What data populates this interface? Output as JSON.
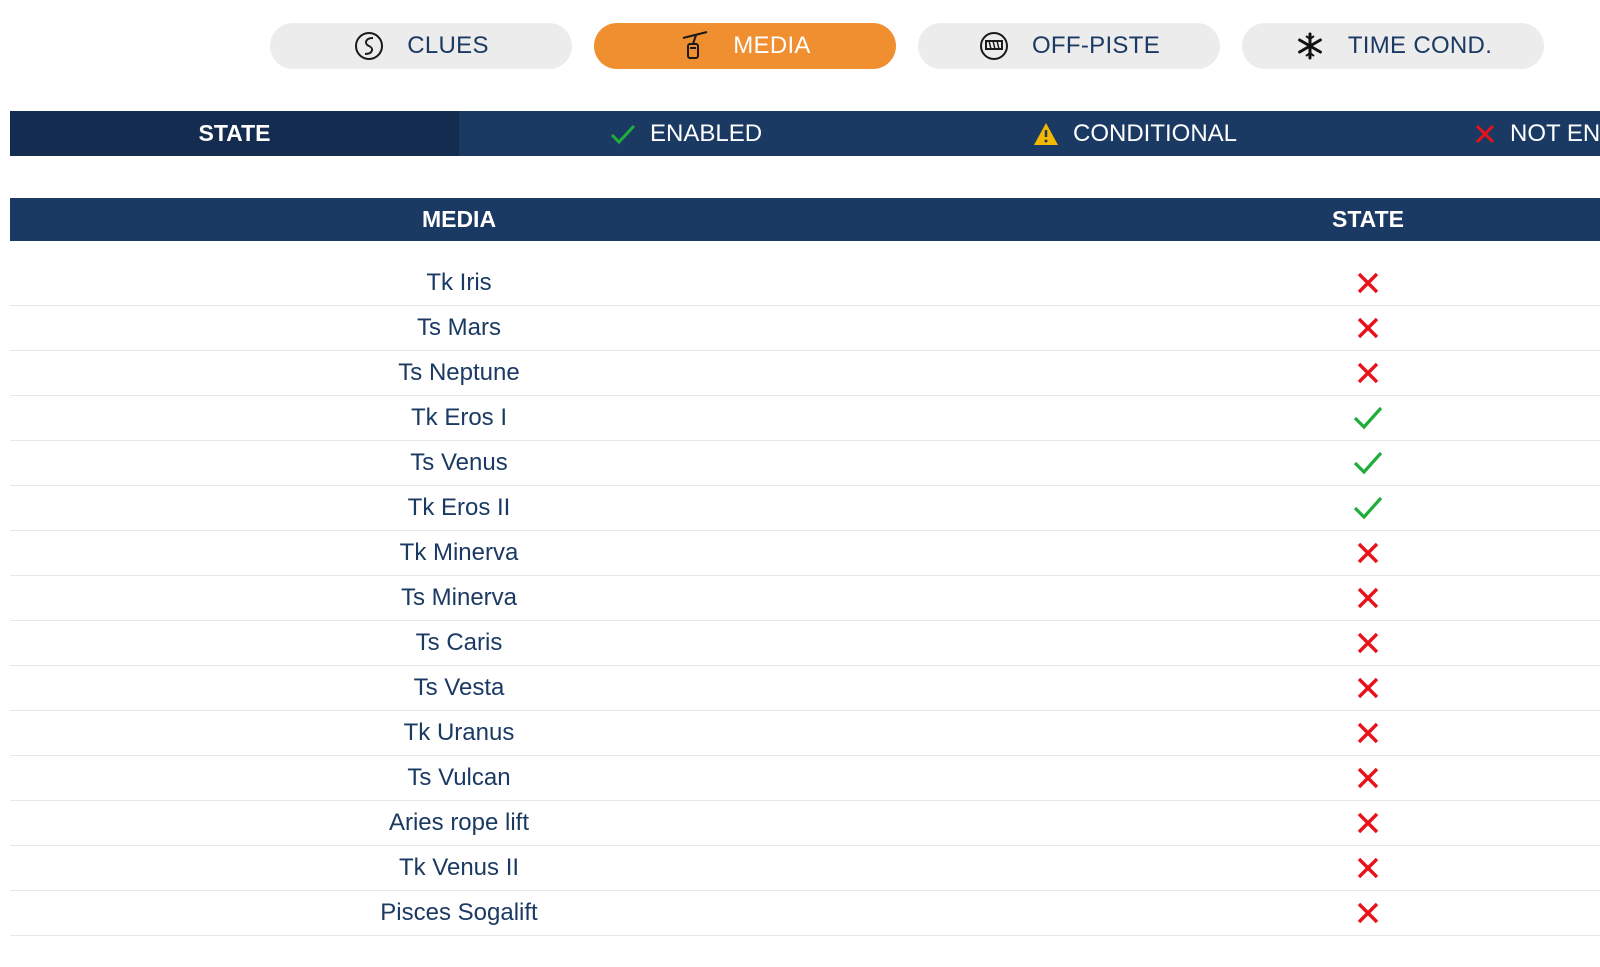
{
  "tabs": [
    {
      "label": "CLUES",
      "icon": "clues-icon",
      "active": false
    },
    {
      "label": "MEDIA",
      "icon": "cable-car-icon",
      "active": true
    },
    {
      "label": "OFF-PISTE",
      "icon": "off-piste-icon",
      "active": false
    },
    {
      "label": "TIME COND.",
      "icon": "snowflake-icon",
      "active": false
    }
  ],
  "legend": {
    "header": "STATE",
    "enabled": "ENABLED",
    "conditional": "CONDITIONAL",
    "not_enabled": "NOT EN"
  },
  "table": {
    "col_media": "MEDIA",
    "col_state": "STATE",
    "rows": [
      {
        "name": "Tk Iris",
        "state": "not-enabled"
      },
      {
        "name": "Ts Mars",
        "state": "not-enabled"
      },
      {
        "name": "Ts Neptune",
        "state": "not-enabled"
      },
      {
        "name": "Tk Eros I",
        "state": "enabled"
      },
      {
        "name": "Ts Venus",
        "state": "enabled"
      },
      {
        "name": "Tk Eros II",
        "state": "enabled"
      },
      {
        "name": "Tk Minerva",
        "state": "not-enabled"
      },
      {
        "name": "Ts Minerva",
        "state": "not-enabled"
      },
      {
        "name": "Ts Caris",
        "state": "not-enabled"
      },
      {
        "name": "Ts Vesta",
        "state": "not-enabled"
      },
      {
        "name": "Tk Uranus",
        "state": "not-enabled"
      },
      {
        "name": "Ts Vulcan",
        "state": "not-enabled"
      },
      {
        "name": "Aries rope lift",
        "state": "not-enabled"
      },
      {
        "name": "Tk Venus II",
        "state": "not-enabled"
      },
      {
        "name": "Pisces Sogalift",
        "state": "not-enabled"
      }
    ]
  },
  "colors": {
    "navy": "#1b3a63",
    "navy_dark": "#142c4f",
    "accent": "#ef8f2f",
    "tab_bg": "#ececec",
    "check": "#1fae3a",
    "cross": "#e8121b",
    "warning": "#f5b800"
  }
}
